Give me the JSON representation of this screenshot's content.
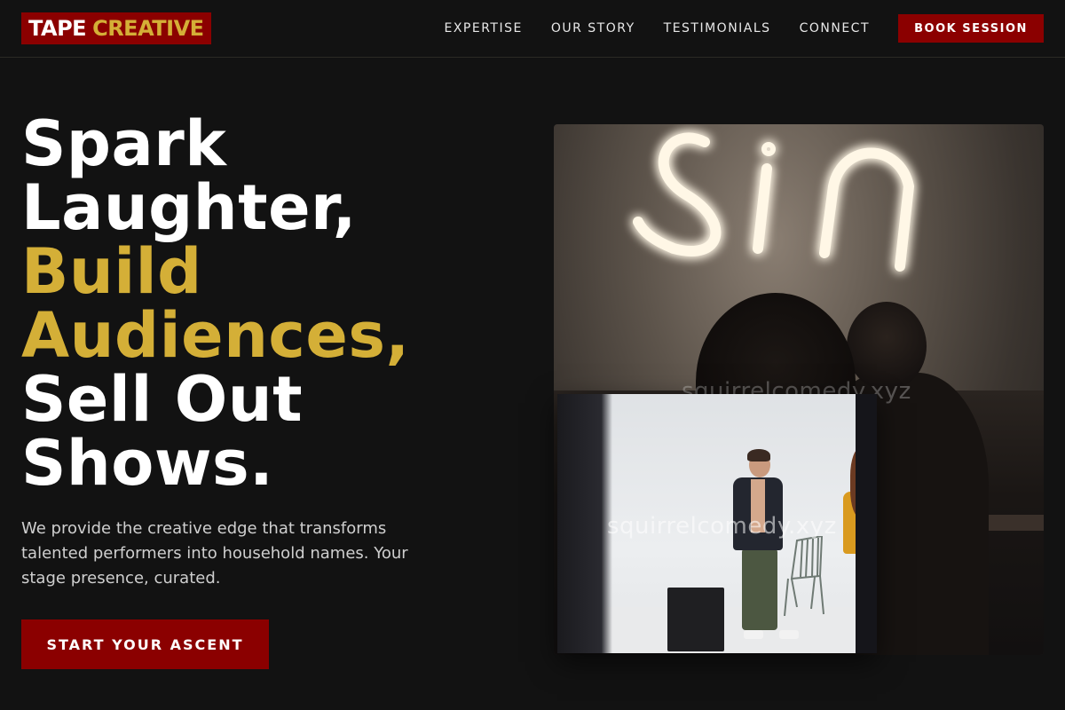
{
  "brand": {
    "word1": "TAPE",
    "word2": "CREATIVE",
    "colors": {
      "primary": "#8b0000",
      "accent": "#d4af37",
      "background": "#121212"
    }
  },
  "nav": {
    "items": [
      {
        "label": "EXPERTISE"
      },
      {
        "label": "OUR STORY"
      },
      {
        "label": "TESTIMONIALS"
      },
      {
        "label": "CONNECT"
      }
    ],
    "cta_label": "BOOK SESSION"
  },
  "hero": {
    "title_lines": [
      {
        "text": "Spark",
        "accent": false
      },
      {
        "text": "Laughter,",
        "accent": false
      },
      {
        "text": "Build",
        "accent": true
      },
      {
        "text": "Audiences,",
        "accent": true
      },
      {
        "text": "Sell Out",
        "accent": false
      },
      {
        "text": "Shows.",
        "accent": false
      }
    ],
    "subtitle": "We provide the creative edge that transforms talented performers into household names. Your stage presence, curated.",
    "cta_label": "START YOUR ASCENT"
  },
  "images": {
    "back_watermark": "squirrelcomedy.xyz",
    "front_watermark": "squirrelcomedy.xyz"
  }
}
